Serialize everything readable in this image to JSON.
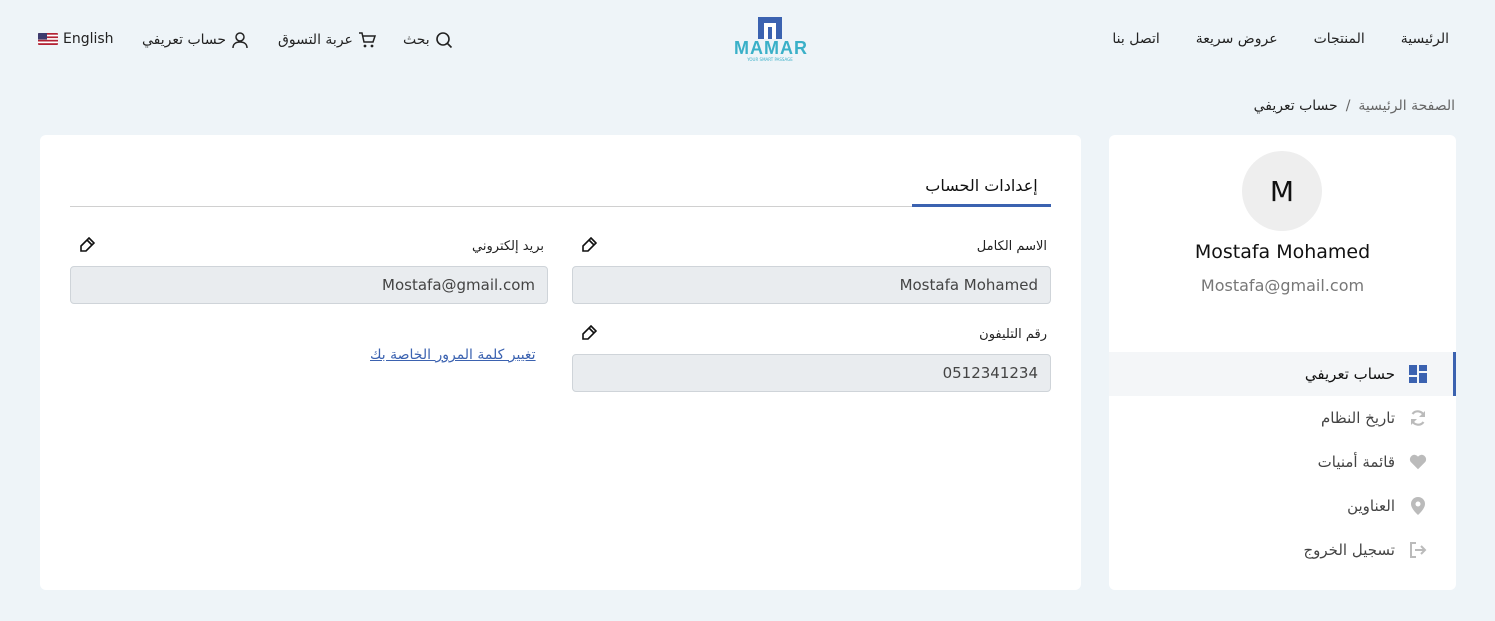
{
  "nav": {
    "home": "الرئيسية",
    "products": "المنتجات",
    "offers": "عروض سريعة",
    "contact": "اتصل بنا",
    "search": "بحث",
    "cart": "عربة التسوق",
    "account": "حساب تعريفي",
    "language": "English"
  },
  "logo": {
    "word": "MAMAR",
    "tagline": "YOUR SMART PASSAGE"
  },
  "breadcrumb": {
    "home": "الصفحة الرئيسية",
    "separator": "/",
    "current": "حساب تعريفي"
  },
  "profile": {
    "initial": "M",
    "name": "Mostafa Mohamed",
    "email": "Mostafa@gmail.com"
  },
  "menu": [
    {
      "label": "حساب تعريفي",
      "icon": "dashboard-icon",
      "active": true
    },
    {
      "label": "تاريخ النظام",
      "icon": "refresh-icon",
      "active": false
    },
    {
      "label": "قائمة أمنيات",
      "icon": "heart-icon",
      "active": false
    },
    {
      "label": "العناوين",
      "icon": "map-pin-icon",
      "active": false
    },
    {
      "label": "تسجيل الخروج",
      "icon": "logout-icon",
      "active": false
    }
  ],
  "settings": {
    "tab": "إعدادات الحساب",
    "full_name_label": "الاسم الكامل",
    "full_name_value": "Mostafa Mohamed",
    "email_label": "بريد إلكتروني",
    "email_value": "Mostafa@gmail.com",
    "phone_label": "رقم التليفون",
    "phone_value": "0512341234",
    "change_password": "تغيير كلمة المرور الخاصة بك"
  },
  "colors": {
    "accent": "#3b62b0",
    "logo": "#3ab0c8",
    "background": "#eef4f8"
  }
}
